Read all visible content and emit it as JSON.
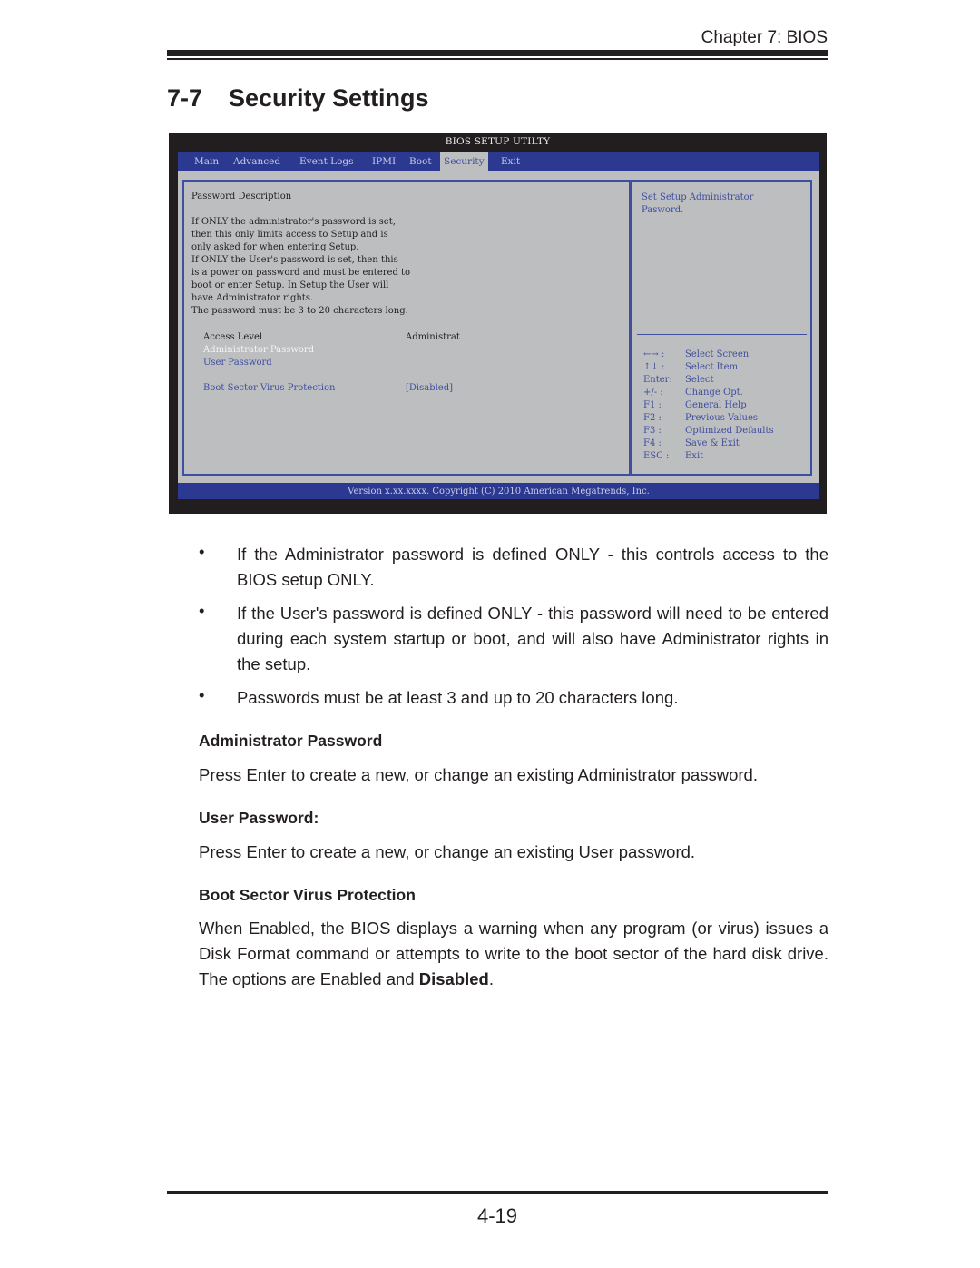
{
  "header": {
    "chapter": "Chapter 7: BIOS",
    "section_number": "7-7",
    "section_title": "Security Settings"
  },
  "bios": {
    "title": "BIOS SETUP UTILTY",
    "tabs": [
      {
        "label": "Main",
        "active": false
      },
      {
        "label": "Advanced",
        "active": false
      },
      {
        "label": "Event Logs",
        "active": false
      },
      {
        "label": "IPMI",
        "active": false
      },
      {
        "label": "Boot",
        "active": false
      },
      {
        "label": "Security",
        "active": true
      },
      {
        "label": "Exit",
        "active": false
      }
    ],
    "description_heading": "Password Description",
    "description_lines": [
      "If ONLY the administrator's password is set,",
      "then this only limits access to Setup and is",
      "only asked for when entering Setup.",
      "If ONLY the User's password is set, then this",
      "is a power on password and must be entered to",
      "boot or enter Setup.  In Setup the User will",
      "have Administrator rights.",
      "The password must be 3 to 20 characters long."
    ],
    "items": [
      {
        "label": "Access Level",
        "value": "Administrat",
        "state": "static"
      },
      {
        "label": "Administrator Password",
        "value": "",
        "state": "selected"
      },
      {
        "label": "User Password",
        "value": "",
        "state": "option"
      },
      {
        "label": "Boot Sector Virus Protection",
        "value": "[Disabled]",
        "state": "option"
      }
    ],
    "help_text": [
      "Set Setup Administrator",
      "Pasword."
    ],
    "keys": [
      {
        "key": "←→ :",
        "action": "Select Screen"
      },
      {
        "key": "↑↓  :",
        "action": "Select Item"
      },
      {
        "key": "Enter:",
        "action": "Select"
      },
      {
        "key": "+/- :",
        "action": "Change Opt."
      },
      {
        "key": "F1 :",
        "action": "General Help"
      },
      {
        "key": "F2 :",
        "action": "Previous Values"
      },
      {
        "key": "F3 :",
        "action": "Optimized Defaults"
      },
      {
        "key": "F4 :",
        "action": "Save & Exit"
      },
      {
        "key": "ESC :",
        "action": "Exit"
      }
    ],
    "footer": "Version x.xx.xxxx. Copyright (C) 2010 American Megatrends, Inc.",
    "colors": {
      "frame": "#221e1f",
      "menubar": "#2b3990",
      "panel": "#bcbec0",
      "accent_text": "#3f4ea1"
    }
  },
  "bullets": [
    "If the Administrator password is defined ONLY - this controls access to the BIOS setup ONLY.",
    "If the User's password is defined ONLY - this password will need to be entered during each system startup or boot, and will also have Administrator rights in the setup.",
    "Passwords must be at least 3 and up to 20 characters long."
  ],
  "bullet_symbol": "•",
  "sections": [
    {
      "heading": "Administrator Password",
      "text": "Press Enter to create a new, or change an existing Administrator password."
    },
    {
      "heading": "User Password:",
      "text": "Press Enter to create a new, or change an existing User password."
    },
    {
      "heading": "Boot Sector Virus Protection",
      "text": "When Enabled, the BIOS displays a warning when any program (or virus) issues a Disk Format command or attempts to write to the boot sector of the hard disk drive. The options are Enabled and ",
      "text_bold": "Disabled",
      "text_end": "."
    }
  ],
  "footer": {
    "page_number": "4-19"
  }
}
